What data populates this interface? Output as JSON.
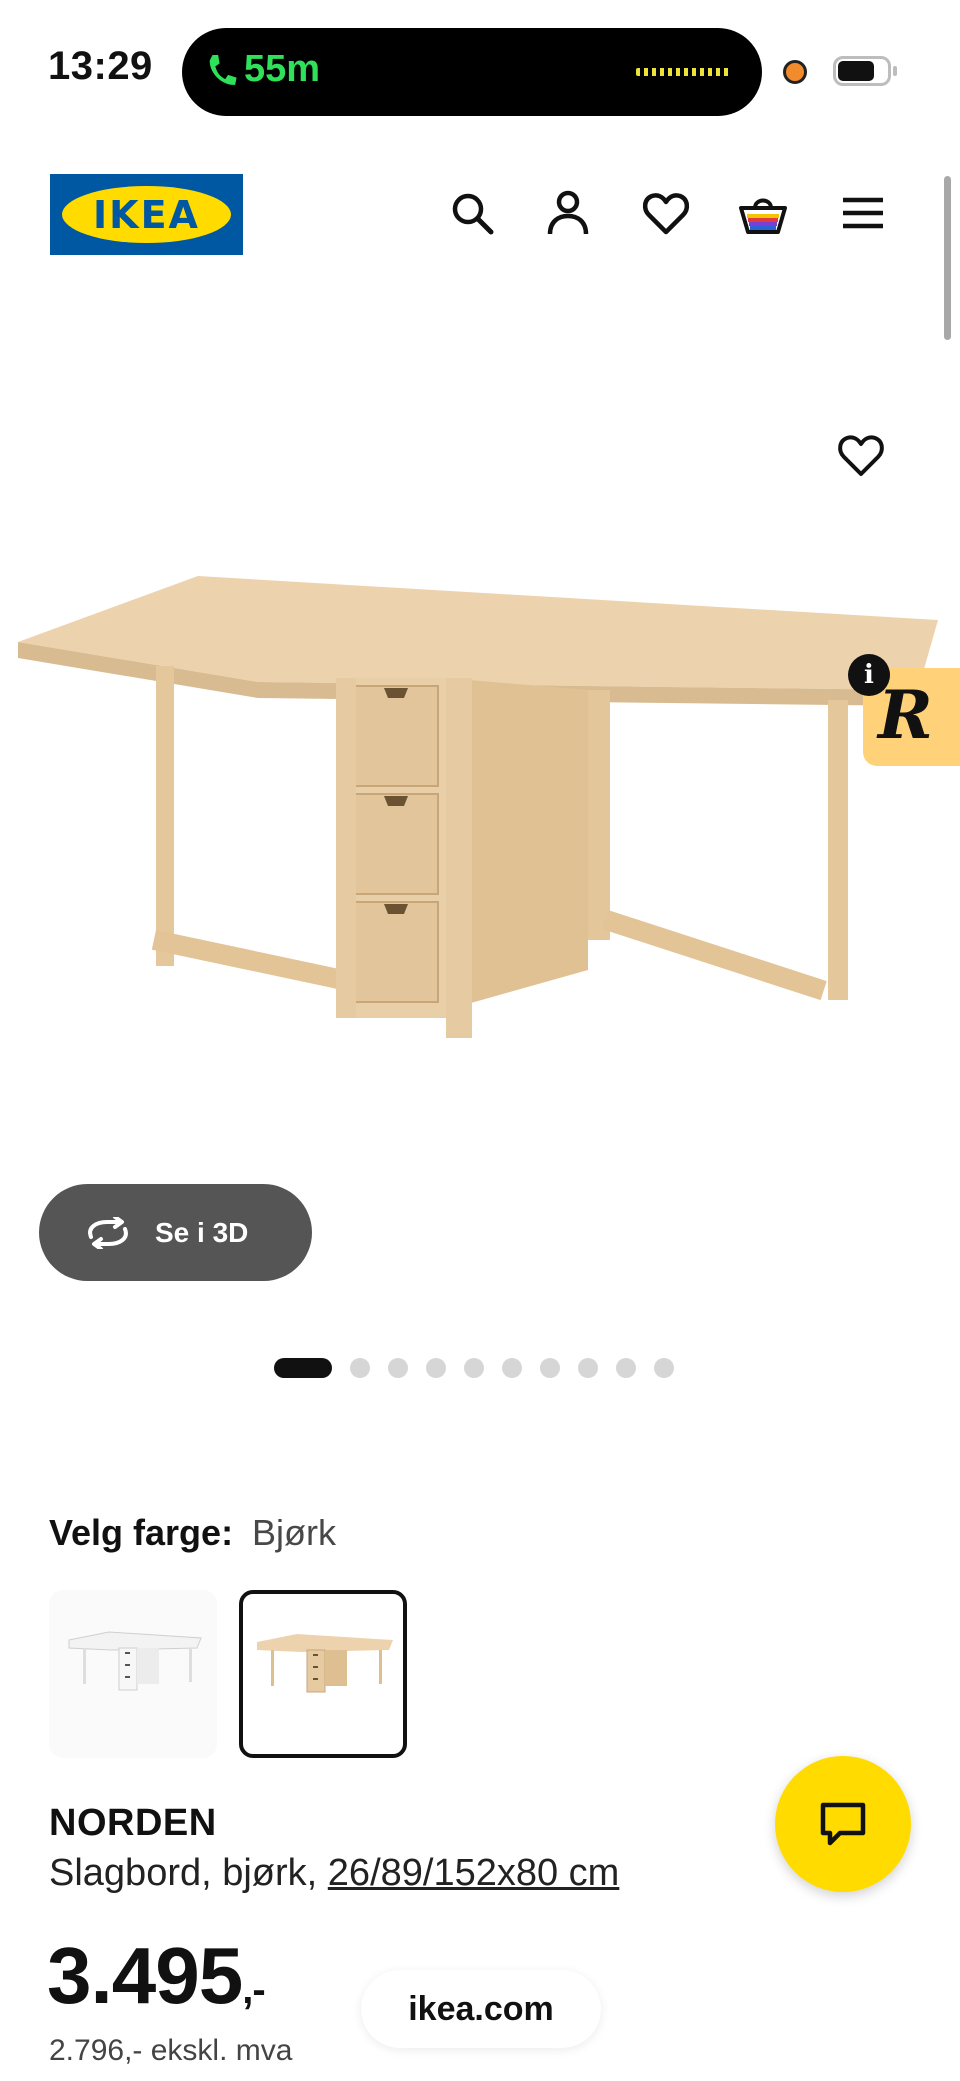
{
  "status_bar": {
    "time": "13:29",
    "call_duration": "55m"
  },
  "header": {
    "logo_text": "IKEA",
    "icons": [
      "search-icon",
      "account-icon",
      "favorites-icon",
      "cart-icon",
      "menu-icon"
    ]
  },
  "gallery": {
    "view_3d_label": "Se i 3D",
    "image_count": 10,
    "active_index": 0
  },
  "badge": {
    "info_label": "i"
  },
  "color_picker": {
    "label": "Velg farge:",
    "selected": "Bjørk",
    "options": [
      "Hvit",
      "Bjørk"
    ]
  },
  "product": {
    "name": "NORDEN",
    "description_prefix": "Slagbord, bjørk,",
    "dimensions": "26/89/152x80 cm",
    "price_main": "3.495",
    "price_suffix": ",-",
    "price_ex_vat": "2.796,- ekskl. mva"
  },
  "browser": {
    "url": "ikea.com"
  },
  "colors": {
    "ikea_blue": "#0058a3",
    "ikea_yellow": "#ffdb00",
    "birch": "#e9cfa8"
  }
}
